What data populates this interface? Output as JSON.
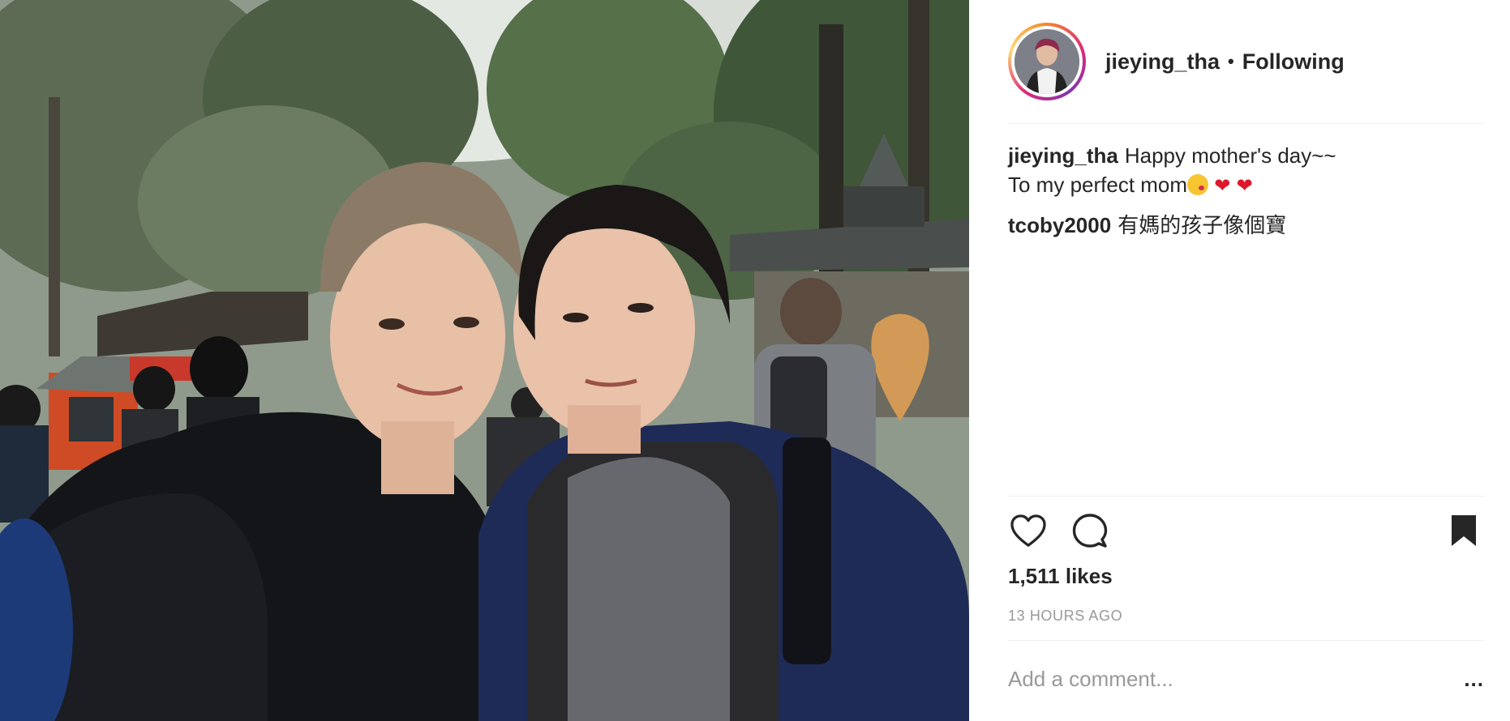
{
  "post": {
    "username": "jieying_tha",
    "separator": "•",
    "follow_status": "Following",
    "avatar_icon": "profile-avatar",
    "photo_alt": "Two women taking a selfie in front of trees and a shrine"
  },
  "comments": [
    {
      "user": "jieying_tha",
      "line1": "Happy mother's day~~",
      "line2": "To my perfect mom",
      "emojis": [
        "kissing-face-emoji",
        "red-heart-emoji",
        "red-heart-emoji"
      ],
      "hearts": "❤️ ❤️"
    },
    {
      "user": "tcoby2000",
      "text": "有媽的孩子像個寶"
    }
  ],
  "actions": {
    "like_icon": "heart-outline-icon",
    "comment_icon": "speech-bubble-icon",
    "save_icon": "bookmark-icon"
  },
  "likes": "1,511 likes",
  "timestamp": "13 HOURS AGO",
  "add_comment": {
    "placeholder": "Add a comment...",
    "more_label": "..."
  },
  "colors": {
    "text": "#262626",
    "muted": "#999999",
    "divider": "#efefef",
    "heart": "#e0162b"
  }
}
